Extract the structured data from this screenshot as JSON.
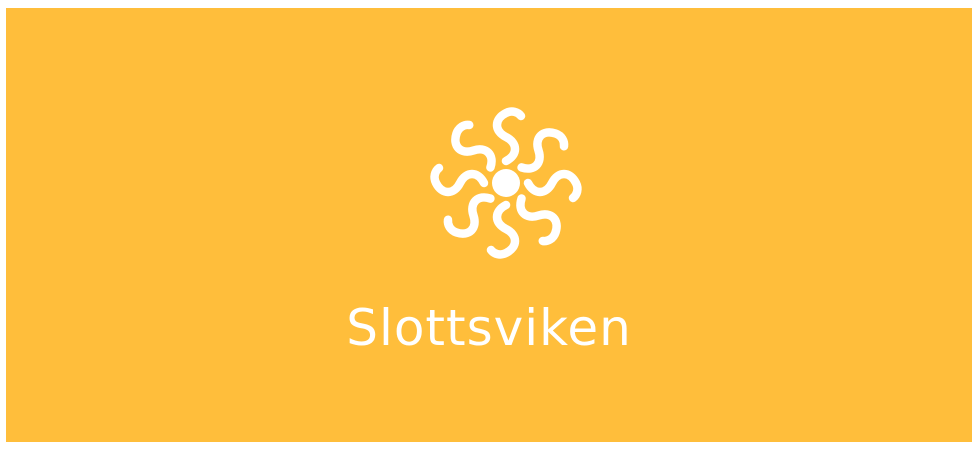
{
  "banner": {
    "brand_name": "Slottsviken",
    "logo_icon": "sun-swirl-icon",
    "background_color": "#ffbe3b",
    "foreground_color": "#ffffff"
  }
}
